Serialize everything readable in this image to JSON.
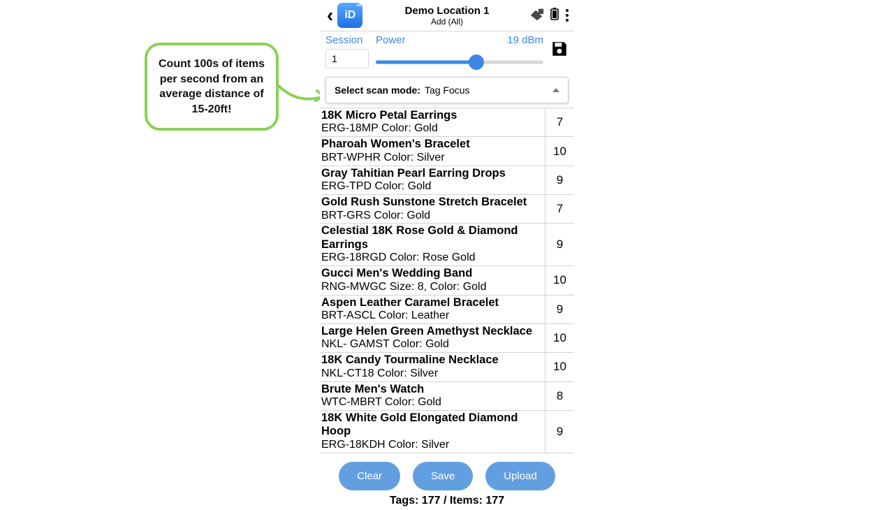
{
  "header": {
    "title": "Demo Location 1",
    "subtitle": "Add (All)",
    "logo_text": "iD"
  },
  "session": {
    "label": "Session",
    "value": "1"
  },
  "power": {
    "label": "Power",
    "value": "19 dBm"
  },
  "scan_mode": {
    "label": "Select scan mode:",
    "value": "Tag Focus"
  },
  "items": [
    {
      "name": "18K Micro Petal Earrings",
      "detail": "ERG-18MP Color: Gold",
      "count": "7"
    },
    {
      "name": "Pharoah Women's Bracelet",
      "detail": "BRT-WPHR Color: Silver",
      "count": "10"
    },
    {
      "name": "Gray Tahitian Pearl Earring Drops",
      "detail": "ERG-TPD Color: Gold",
      "count": "9"
    },
    {
      "name": "Gold Rush Sunstone Stretch Bracelet",
      "detail": "BRT-GRS Color: Gold",
      "count": "7"
    },
    {
      "name": "Celestial 18K Rose Gold & Diamond Earrings",
      "detail": "ERG-18RGD Color: Rose Gold",
      "count": "9"
    },
    {
      "name": "Gucci Men's Wedding Band",
      "detail": "RNG-MWGC Size: 8, Color: Gold",
      "count": "10"
    },
    {
      "name": "Aspen Leather Caramel Bracelet",
      "detail": "BRT-ASCL Color: Leather",
      "count": "9"
    },
    {
      "name": "Large Helen Green Amethyst Necklace",
      "detail": "NKL- GAMST Color: Gold",
      "count": "10"
    },
    {
      "name": "18K Candy Tourmaline Necklace",
      "detail": "NKL-CT18 Color: Silver",
      "count": "10"
    },
    {
      "name": "Brute Men's Watch",
      "detail": "WTC-MBRT Color: Gold",
      "count": "8"
    },
    {
      "name": "18K White Gold Elongated Diamond Hoop",
      "detail": "ERG-18KDH Color: Silver",
      "count": "9"
    }
  ],
  "buttons": {
    "clear": "Clear",
    "save": "Save",
    "upload": "Upload"
  },
  "summary": "Tags: 177 / Items: 177",
  "callout": "Count 100s of items per second from an average distance of 15-20ft!"
}
